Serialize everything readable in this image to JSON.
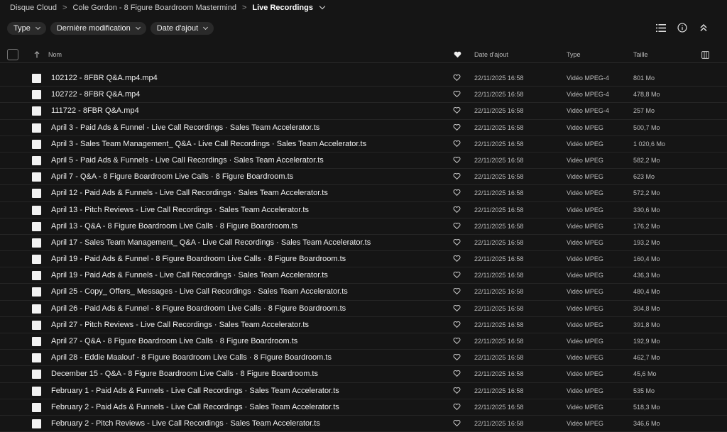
{
  "breadcrumb": {
    "items": [
      "Disque Cloud",
      "Cole Gordon - 8 Figure Boardroom Mastermind",
      "Live Recordings"
    ]
  },
  "filters": [
    "Type",
    "Dernière modification",
    "Date d'ajout"
  ],
  "columns": {
    "name": "Nom",
    "date": "Date d'ajout",
    "type": "Type",
    "size": "Taille"
  },
  "files": [
    {
      "name": "102122 - 8FBR Q&A.mp4.mp4",
      "date": "22/11/2025 16:58",
      "type": "Vidéo MPEG-4",
      "size": "801 Mo"
    },
    {
      "name": "102722 - 8FBR Q&A.mp4",
      "date": "22/11/2025 16:58",
      "type": "Vidéo MPEG-4",
      "size": "478,8 Mo"
    },
    {
      "name": "111722 - 8FBR Q&A.mp4",
      "date": "22/11/2025 16:58",
      "type": "Vidéo MPEG-4",
      "size": "257 Mo"
    },
    {
      "name": "April 3 - Paid Ads & Funnel - Live Call Recordings · Sales Team Accelerator.ts",
      "date": "22/11/2025 16:58",
      "type": "Vidéo MPEG",
      "size": "500,7 Mo"
    },
    {
      "name": "April 3 - Sales Team Management_ Q&A - Live Call Recordings · Sales Team Accelerator.ts",
      "date": "22/11/2025 16:58",
      "type": "Vidéo MPEG",
      "size": "1 020,6 Mo"
    },
    {
      "name": "April 5 - Paid Ads & Funnels - Live Call Recordings · Sales Team Accelerator.ts",
      "date": "22/11/2025 16:58",
      "type": "Vidéo MPEG",
      "size": "582,2 Mo"
    },
    {
      "name": "April 7 - Q&A - 8 Figure Boardroom Live Calls · 8 Figure Boardroom.ts",
      "date": "22/11/2025 16:58",
      "type": "Vidéo MPEG",
      "size": "623 Mo"
    },
    {
      "name": "April 12 - Paid Ads & Funnels - Live Call Recordings · Sales Team Accelerator.ts",
      "date": "22/11/2025 16:58",
      "type": "Vidéo MPEG",
      "size": "572,2 Mo"
    },
    {
      "name": "April 13 - Pitch Reviews - Live Call Recordings · Sales Team Accelerator.ts",
      "date": "22/11/2025 16:58",
      "type": "Vidéo MPEG",
      "size": "330,6 Mo"
    },
    {
      "name": "April 13 - Q&A - 8 Figure Boardroom Live Calls · 8 Figure Boardroom.ts",
      "date": "22/11/2025 16:58",
      "type": "Vidéo MPEG",
      "size": "176,2 Mo"
    },
    {
      "name": "April 17 - Sales Team Management_ Q&A - Live Call Recordings · Sales Team Accelerator.ts",
      "date": "22/11/2025 16:58",
      "type": "Vidéo MPEG",
      "size": "193,2 Mo"
    },
    {
      "name": "April 19 - Paid Ads & Funnel - 8 Figure Boardroom Live Calls · 8 Figure Boardroom.ts",
      "date": "22/11/2025 16:58",
      "type": "Vidéo MPEG",
      "size": "160,4 Mo"
    },
    {
      "name": "April 19 - Paid Ads & Funnels - Live Call Recordings · Sales Team Accelerator.ts",
      "date": "22/11/2025 16:58",
      "type": "Vidéo MPEG",
      "size": "436,3 Mo"
    },
    {
      "name": "April 25 - Copy_ Offers_ Messages - Live Call Recordings · Sales Team Accelerator.ts",
      "date": "22/11/2025 16:58",
      "type": "Vidéo MPEG",
      "size": "480,4 Mo"
    },
    {
      "name": "April 26 - Paid Ads & Funnel - 8 Figure Boardroom Live Calls · 8 Figure Boardroom.ts",
      "date": "22/11/2025 16:58",
      "type": "Vidéo MPEG",
      "size": "304,8 Mo"
    },
    {
      "name": "April 27 - Pitch Reviews - Live Call Recordings · Sales Team Accelerator.ts",
      "date": "22/11/2025 16:58",
      "type": "Vidéo MPEG",
      "size": "391,8 Mo"
    },
    {
      "name": "April 27 - Q&A - 8 Figure Boardroom Live Calls · 8 Figure Boardroom.ts",
      "date": "22/11/2025 16:58",
      "type": "Vidéo MPEG",
      "size": "192,9 Mo"
    },
    {
      "name": "April 28 - Eddie Maalouf - 8 Figure Boardroom Live Calls · 8 Figure Boardroom.ts",
      "date": "22/11/2025 16:58",
      "type": "Vidéo MPEG",
      "size": "462,7 Mo"
    },
    {
      "name": "December 15 - Q&A - 8 Figure Boardroom Live Calls · 8 Figure Boardroom.ts",
      "date": "22/11/2025 16:58",
      "type": "Vidéo MPEG",
      "size": "45,6 Mo"
    },
    {
      "name": "February 1 - Paid Ads & Funnels - Live Call Recordings · Sales Team Accelerator.ts",
      "date": "22/11/2025 16:58",
      "type": "Vidéo MPEG",
      "size": "535 Mo"
    },
    {
      "name": "February 2 - Paid Ads & Funnels - Live Call Recordings · Sales Team Accelerator.ts",
      "date": "22/11/2025 16:58",
      "type": "Vidéo MPEG",
      "size": "518,3 Mo"
    },
    {
      "name": "February 2 - Pitch Reviews - Live Call Recordings · Sales Team Accelerator.ts",
      "date": "22/11/2025 16:58",
      "type": "Vidéo MPEG",
      "size": "346,6 Mo"
    }
  ]
}
